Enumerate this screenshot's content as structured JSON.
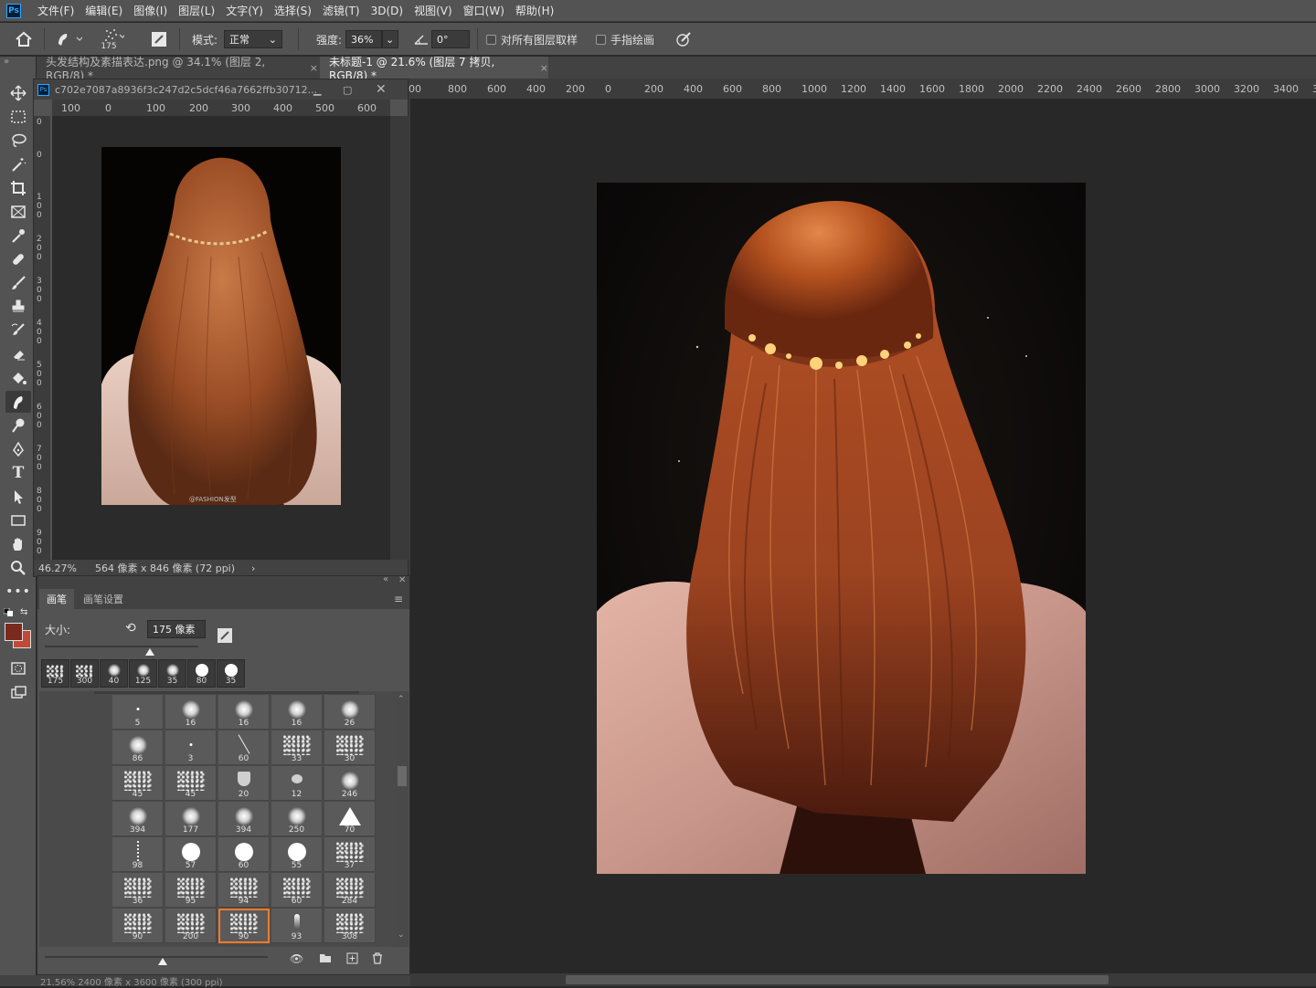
{
  "menu": [
    "文件(F)",
    "编辑(E)",
    "图像(I)",
    "图层(L)",
    "文字(Y)",
    "选择(S)",
    "滤镜(T)",
    "3D(D)",
    "视图(V)",
    "窗口(W)",
    "帮助(H)"
  ],
  "app_logo": "Ps",
  "options": {
    "brush_size": "175",
    "mode_label": "模式:",
    "mode_value": "正常",
    "strength_label": "强度:",
    "strength_value": "36%",
    "angle_value": "0°",
    "sample_all_layers": "对所有图层取样",
    "finger_painting": "手指绘画"
  },
  "tabs": [
    {
      "label": "头发结构及素描表达.png @ 34.1% (图层 2, RGB/8) *",
      "close": "×"
    },
    {
      "label": "未标题-1 @ 21.6% (图层 7 拷贝, RGB/8) *",
      "close": "×"
    }
  ],
  "float_doc": {
    "title": "c702e7087a8936f3c247d2c5dcf46a7662ffb30712...",
    "zoom": "46.27%",
    "info": "564 像素 x 846 像素 (72 ppi)",
    "ruler_h": [
      "100",
      "0",
      "100",
      "200",
      "300",
      "400",
      "500",
      "600"
    ],
    "ruler_v": [
      "0",
      "0",
      "1 0 0",
      "2 0 0",
      "3 0 0",
      "4 0 0",
      "5 0 0",
      "6 0 0",
      "7 0 0",
      "8 0 0",
      "9 0 0"
    ],
    "watermark": "@FASHION发型"
  },
  "main_ruler": [
    "00",
    "800",
    "600",
    "400",
    "200",
    "0",
    "200",
    "400",
    "600",
    "800",
    "1000",
    "1200",
    "1400",
    "1600",
    "1800",
    "2000",
    "2200",
    "2400",
    "2600",
    "2800",
    "3000",
    "3200",
    "3400",
    "36"
  ],
  "brush_panel": {
    "tab_brush": "画笔",
    "tab_settings": "画笔设置",
    "size_label": "大小:",
    "size_value": "175 像素",
    "recent": [
      "175",
      "300",
      "40",
      "125",
      "35",
      "80",
      "35"
    ],
    "grid": [
      [
        "5",
        "16",
        "16",
        "16",
        "26"
      ],
      [
        "86",
        "3",
        "60",
        "33",
        "30"
      ],
      [
        "45",
        "45",
        "20",
        "12",
        "246"
      ],
      [
        "394",
        "177",
        "394",
        "250",
        "70"
      ],
      [
        "98",
        "57",
        "60",
        "55",
        "37"
      ],
      [
        "36",
        "95",
        "94",
        "60",
        "284"
      ],
      [
        "90",
        "200",
        "90",
        "93",
        "308"
      ]
    ]
  },
  "status_text": "21.56%   2400 像素 x 3600 像素 (300 ppi)",
  "colors": {
    "foreground": "#7a2a1d",
    "background": "#c04a36",
    "accent_selection": "#ff7a2a",
    "ps_blue": "#31a8ff"
  }
}
